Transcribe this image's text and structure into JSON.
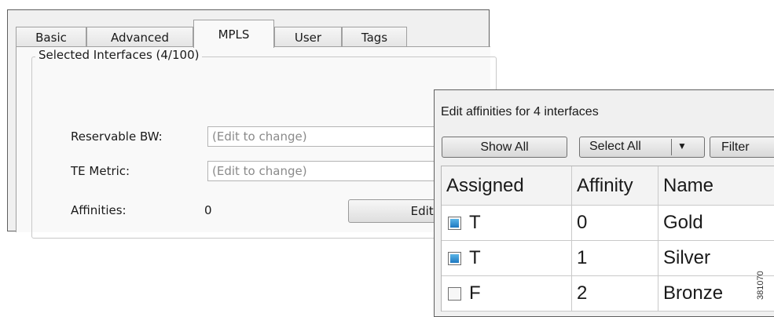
{
  "main_window": {
    "tabs": [
      {
        "label": "Basic",
        "active": false
      },
      {
        "label": "Advanced",
        "active": false
      },
      {
        "label": "MPLS",
        "active": true
      },
      {
        "label": "User",
        "active": false
      },
      {
        "label": "Tags",
        "active": false
      }
    ],
    "group_title": "Selected Interfaces (4/100)",
    "reservable_bw": {
      "label": "Reservable BW:",
      "placeholder": "(Edit to change)"
    },
    "te_metric": {
      "label": "TE Metric:",
      "placeholder": "(Edit to change)"
    },
    "affinities": {
      "label": "Affinities:",
      "value": "0",
      "button": "Edit..."
    }
  },
  "popup": {
    "title": "Edit affinities for 4 interfaces",
    "buttons": {
      "show_all": "Show All",
      "select_all": "Select All",
      "filter": "Filter"
    },
    "columns": [
      "Assigned",
      "Affinity",
      "Name"
    ],
    "rows": [
      {
        "assigned": "T",
        "checked": true,
        "affinity": "0",
        "name": "Gold"
      },
      {
        "assigned": "T",
        "checked": true,
        "affinity": "1",
        "name": "Silver"
      },
      {
        "assigned": "F",
        "checked": false,
        "affinity": "2",
        "name": "Bronze"
      }
    ]
  },
  "figure_id": "381070"
}
